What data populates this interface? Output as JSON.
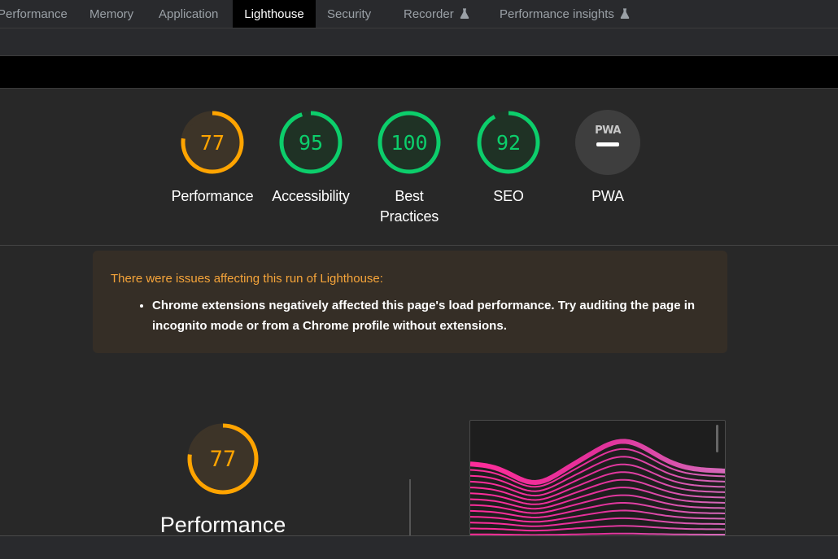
{
  "tabs": [
    {
      "label": "Performance",
      "active": false
    },
    {
      "label": "Memory",
      "active": false
    },
    {
      "label": "Application",
      "active": false
    },
    {
      "label": "Lighthouse",
      "active": true
    },
    {
      "label": "Security",
      "active": false
    },
    {
      "label": "Recorder",
      "active": false,
      "experimental": true
    },
    {
      "label": "Performance insights",
      "active": false,
      "experimental": true
    }
  ],
  "gauges": [
    {
      "label": "Performance",
      "score": "77",
      "fraction": 0.77,
      "color": "#ffa400",
      "bg": "#3d3428"
    },
    {
      "label": "Accessibility",
      "score": "95",
      "fraction": 0.95,
      "color": "#0cce6b",
      "bg": "#1f3225"
    },
    {
      "label_line1": "Best",
      "label_line2": "Practices",
      "score": "100",
      "fraction": 1.0,
      "color": "#0cce6b",
      "bg": "#1f3225"
    },
    {
      "label": "SEO",
      "score": "92",
      "fraction": 0.92,
      "color": "#0cce6b",
      "bg": "#1f3225"
    },
    {
      "label": "PWA",
      "badge": "PWA",
      "color": "#c8c8c8",
      "bg": "#3e3e3e"
    }
  ],
  "warning": {
    "title": "There were issues affecting this run of Lighthouse:",
    "items": [
      "Chrome extensions negatively affected this page's load performance. Try auditing the page in incognito mode or from a Chrome profile without extensions."
    ],
    "title_color": "#f7a53a",
    "bg": "#352e26"
  },
  "detail": {
    "score": "77",
    "fraction": 0.77,
    "label": "Performance",
    "color": "#ffa400"
  }
}
